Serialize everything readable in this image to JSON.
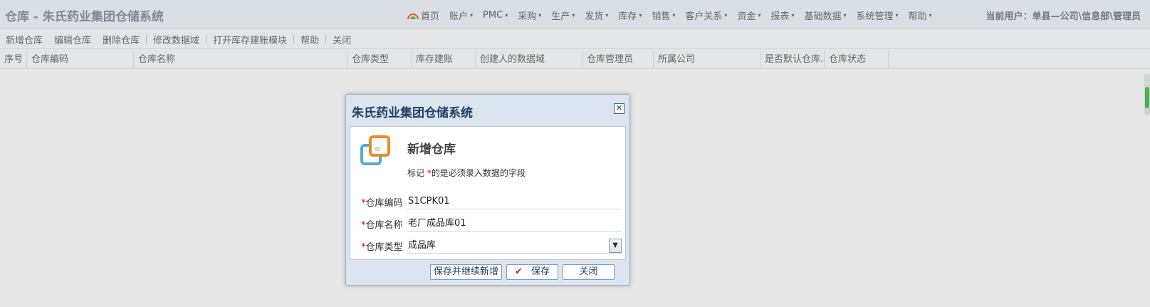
{
  "header": {
    "app_title": "仓库 - 朱氏药业集团仓储系统",
    "menus": [
      {
        "label": "首页",
        "icon": "rainbow-icon",
        "caret": false
      },
      {
        "label": "账户",
        "caret": true
      },
      {
        "label": "PMC",
        "caret": true
      },
      {
        "label": "采购",
        "caret": true
      },
      {
        "label": "生产",
        "caret": true
      },
      {
        "label": "发货",
        "caret": true
      },
      {
        "label": "库存",
        "caret": true
      },
      {
        "label": "销售",
        "caret": true
      },
      {
        "label": "客户关系",
        "caret": true
      },
      {
        "label": "资金",
        "caret": true
      },
      {
        "label": "报表",
        "caret": true
      },
      {
        "label": "基础数据",
        "caret": true
      },
      {
        "label": "系统管理",
        "caret": true
      },
      {
        "label": "帮助",
        "caret": true
      }
    ],
    "current_user": "当前用户：单县—公司\\信息部\\管理员"
  },
  "toolbar": {
    "add": "新增仓库",
    "edit": "编辑仓库",
    "delete": "删除仓库",
    "modify_domain": "修改数据域",
    "open_module": "打开库存建账模块",
    "help": "帮助",
    "close": "关闭"
  },
  "grid": {
    "columns": [
      "序号",
      "仓库编码",
      "仓库名称",
      "仓库类型",
      "库存建账",
      "创建人的数据域",
      "仓库管理员",
      "所属公司",
      "是否默认仓库..",
      "仓库状态"
    ]
  },
  "dialog": {
    "title": "朱氏药业集团仓储系统",
    "heading": "新增仓库",
    "hint_prefix": "标记 ",
    "hint_star": "*",
    "hint_suffix": "的是必须录入数据的字段",
    "fields": [
      {
        "label": "仓库编码",
        "value": "S1CPK01"
      },
      {
        "label": "仓库名称",
        "value": "老厂成品库01"
      },
      {
        "label": "仓库类型",
        "value": "成品库"
      }
    ],
    "buttons": {
      "save_continue": "保存并继续新增",
      "save": "保存",
      "close": "关闭"
    }
  },
  "colors": {
    "accent": "#1f3f66",
    "required": "#d0021b",
    "scroll_thumb": "#4caf50"
  }
}
